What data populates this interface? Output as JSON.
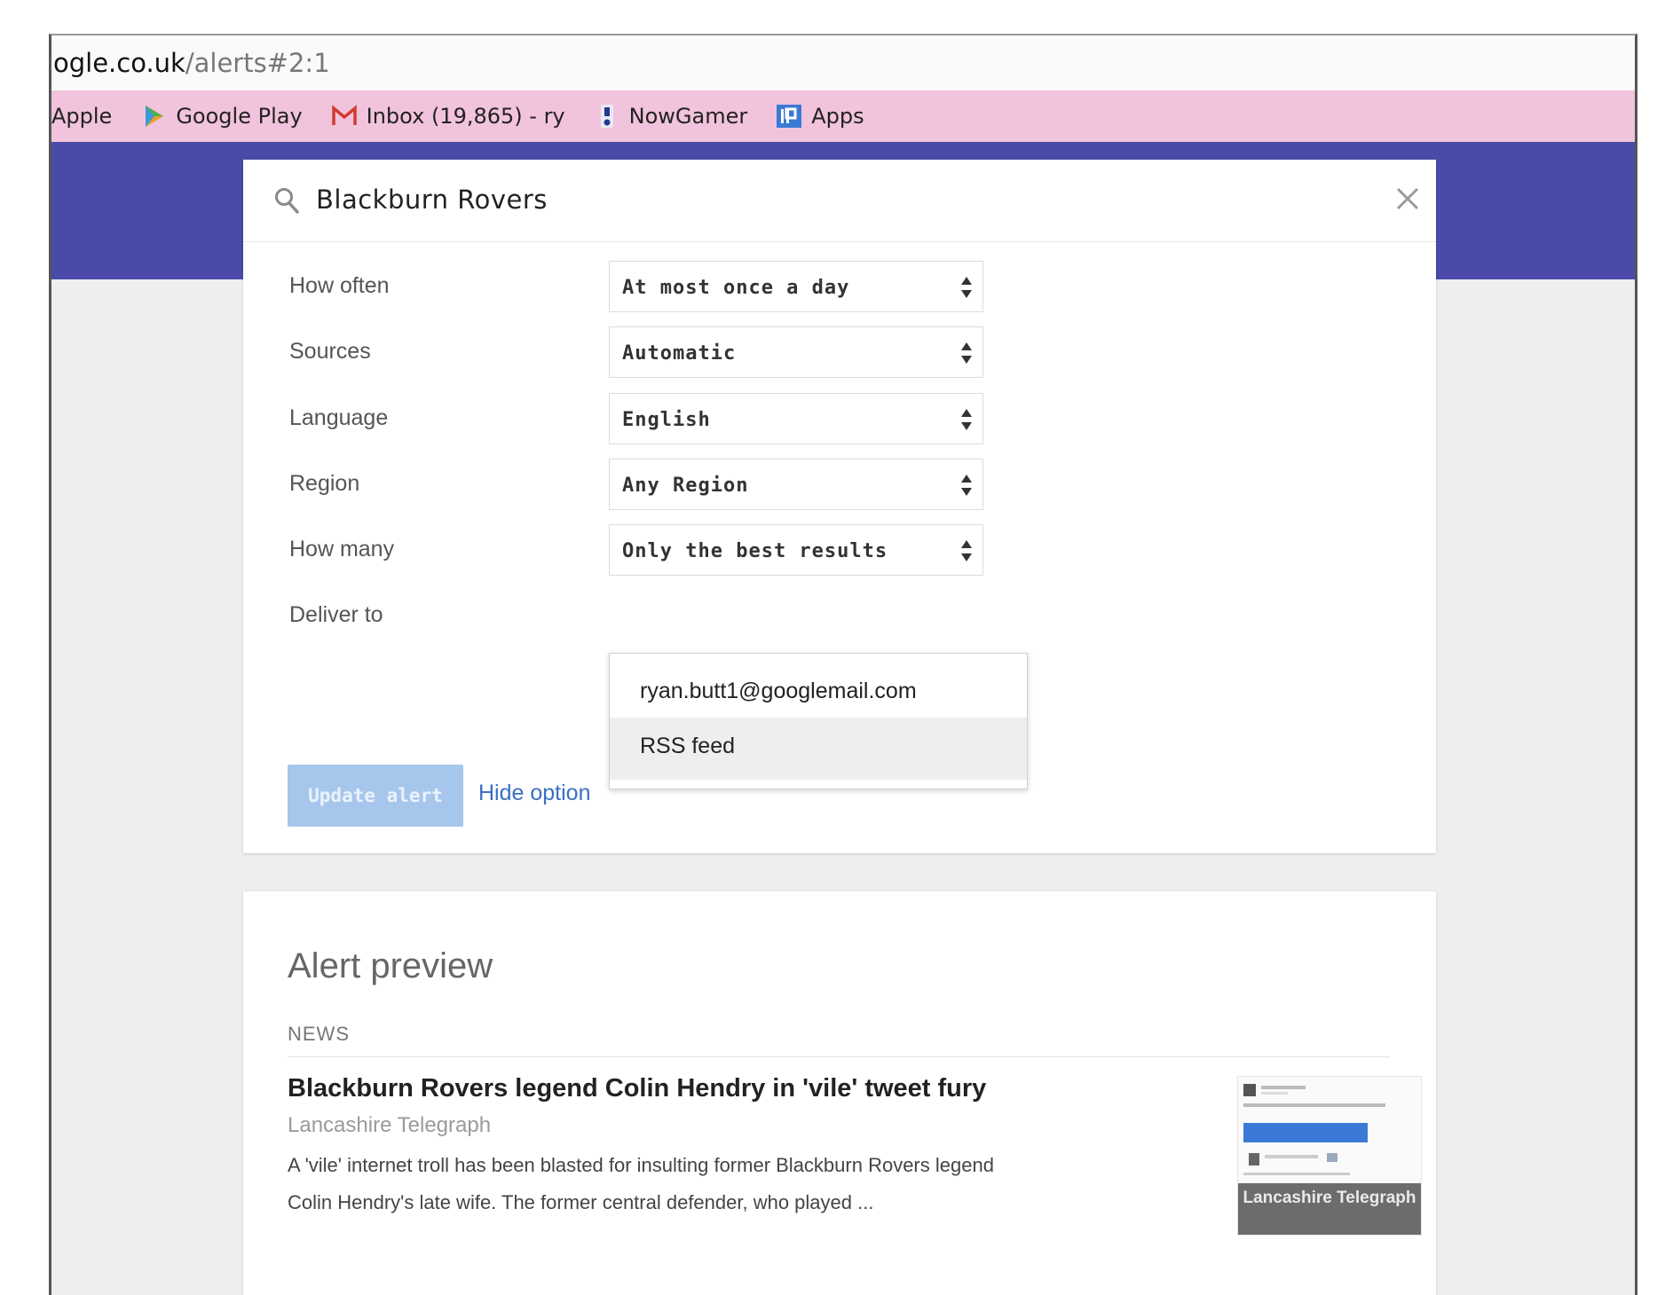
{
  "url": {
    "domain": "ogle.co.uk",
    "path": "/alerts#2:1"
  },
  "bookmarks": [
    {
      "label": "Apple",
      "icon": "apple-icon"
    },
    {
      "label": "Google Play",
      "icon": "google-play-icon"
    },
    {
      "label": "Inbox (19,865) - ry",
      "icon": "gmail-icon"
    },
    {
      "label": "NowGamer",
      "icon": "nowgamer-icon"
    },
    {
      "label": "Apps",
      "icon": "apps-icon"
    }
  ],
  "colors": {
    "banner": "#4a4aa8",
    "bookmarks_bar": "#f2c3dc",
    "update_button": "#a7c6ec",
    "link": "#3b6fc4"
  },
  "alert": {
    "query": "Blackburn Rovers",
    "options": [
      {
        "label": "How often",
        "value": "At most once a day"
      },
      {
        "label": "Sources",
        "value": "Automatic"
      },
      {
        "label": "Language",
        "value": "English"
      },
      {
        "label": "Region",
        "value": "Any Region"
      },
      {
        "label": "How many",
        "value": "Only the best results"
      }
    ],
    "deliver_label": "Deliver to",
    "deliver_options": [
      "ryan.butt1@googlemail.com",
      "RSS feed"
    ],
    "update_button": "Update alert",
    "hide_options": "Hide option"
  },
  "preview": {
    "title": "Alert preview",
    "section": "NEWS",
    "article": {
      "title": "Blackburn Rovers legend Colin Hendry in 'vile' tweet fury",
      "source": "Lancashire Telegraph",
      "snippet_line1": "A 'vile' internet troll has been blasted for insulting former Blackburn Rovers legend",
      "snippet_line2": "Colin Hendry's late wife. The former central defender, who played ...",
      "thumb_caption": "Lancashire Telegraph"
    }
  }
}
